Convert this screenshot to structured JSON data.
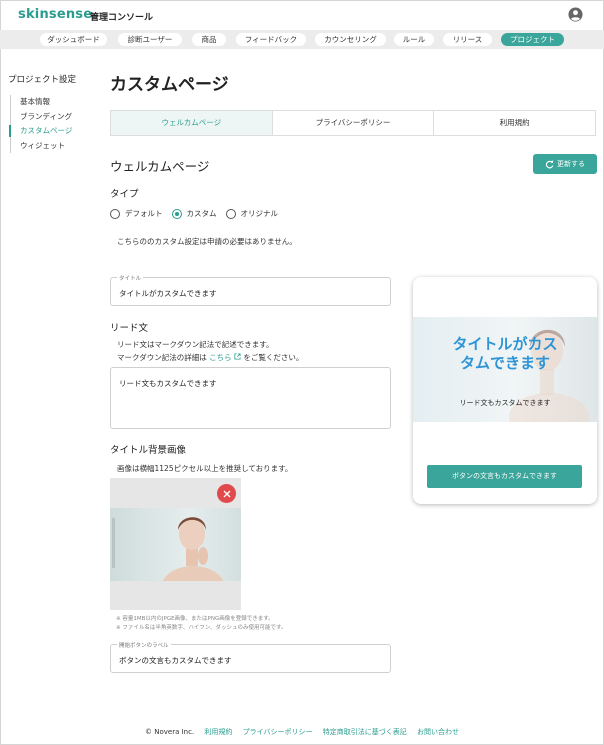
{
  "header": {
    "logo": "skinsense",
    "console_label": "管理コンソール",
    "user_icon": "user-account-icon"
  },
  "nav": {
    "items": [
      {
        "label": "ダッシュボード"
      },
      {
        "label": "診断ユーザー"
      },
      {
        "label": "商品"
      },
      {
        "label": "フィードバック"
      },
      {
        "label": "カウンセリング"
      },
      {
        "label": "ルール"
      },
      {
        "label": "リリース"
      },
      {
        "label": "プロジェクト",
        "active": true
      }
    ]
  },
  "sidebar": {
    "title": "プロジェクト設定",
    "items": [
      {
        "label": "基本情報"
      },
      {
        "label": "ブランディング"
      },
      {
        "label": "カスタムページ",
        "active": true
      },
      {
        "label": "ウィジェット"
      }
    ]
  },
  "main": {
    "page_title": "カスタムページ",
    "tabs": [
      {
        "label": "ウェルカムページ",
        "active": true
      },
      {
        "label": "プライバシーポリシー"
      },
      {
        "label": "利用規約"
      }
    ],
    "section_title": "ウェルカムページ",
    "refresh_button": "更新する",
    "type_label": "タイプ",
    "type_options": [
      {
        "label": "デフォルト",
        "checked": false
      },
      {
        "label": "カスタム",
        "checked": true
      },
      {
        "label": "オリジナル",
        "checked": false
      }
    ],
    "type_note": "こちらののカスタム設定は申請の必要はありません。",
    "title_field": {
      "legend": "タイトル",
      "value": "タイトルがカスタムできます"
    },
    "lead_label": "リード文",
    "lead_note_1": "リード文はマークダウン記法で記述できます。",
    "lead_note_2_prefix": "マークダウン記法の詳細は",
    "lead_note_2_link": "こちら",
    "lead_note_2_suffix": "をご覧ください。",
    "lead_field": {
      "value": "リード文もカスタムできます"
    },
    "bg_image_label": "タイトル背景画像",
    "bg_image_note": "画像は横幅1125ピクセル以上を推奨しております。",
    "bg_image_hint_1": "※ 容量1MB以内のJPGE画像、またはPNG画像を登録できます。",
    "bg_image_hint_2": "※ ファイル名は半角英数字、ハイフン、ダッシュのみ使用可能です。",
    "button_field": {
      "legend": "開始ボタンのラベル",
      "value": "ボタンの文言もカスタムできます"
    }
  },
  "preview": {
    "title": "タイトルがカスタムできます",
    "lead": "リード文もカスタムできます",
    "button": "ボタンの文言もカスタムできます"
  },
  "footer": {
    "copyright": "© Novera Inc.",
    "links": [
      "利用規約",
      "プライバシーポリシー",
      "特定商取引法に基づく表記",
      "お問い合わせ"
    ]
  },
  "colors": {
    "accent": "#3aa59a",
    "preview_title": "#2d95d6",
    "delete": "#e04a4a"
  }
}
